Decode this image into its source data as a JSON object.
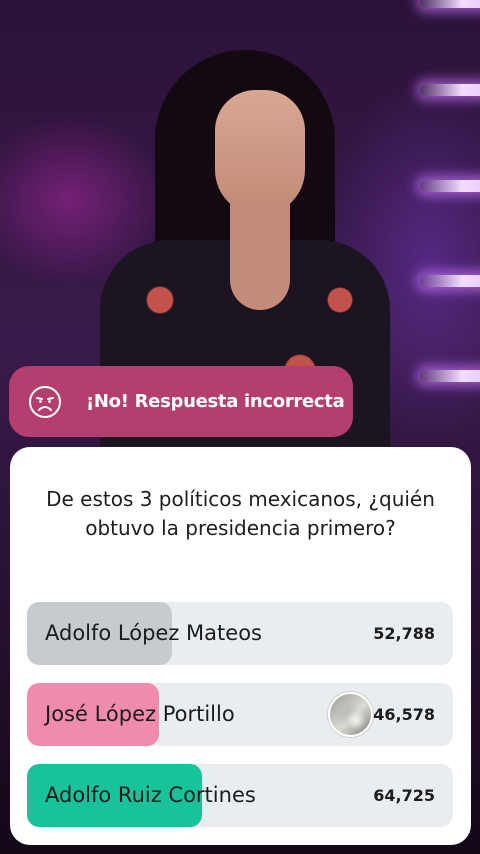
{
  "banner": {
    "text": "¡No! Respuesta incorrecta",
    "icon": "sad-face-icon",
    "color": "#b43f6e"
  },
  "question": {
    "text": "De estos 3 políticos mexicanos, ¿quién obtuvo la presidencia primero?"
  },
  "options": [
    {
      "name": "Adolfo López Mateos",
      "votes": "52,788",
      "fill_color": "#c5cbce",
      "fill_fraction": 0.34,
      "avatar": false
    },
    {
      "name": "José López Portillo",
      "votes": "46,578",
      "fill_color": "#f08bac",
      "fill_fraction": 0.31,
      "avatar": true
    },
    {
      "name": "Adolfo Ruiz Cortines",
      "votes": "64,725",
      "fill_color": "#18c29a",
      "fill_fraction": 0.41,
      "avatar": false
    }
  ]
}
